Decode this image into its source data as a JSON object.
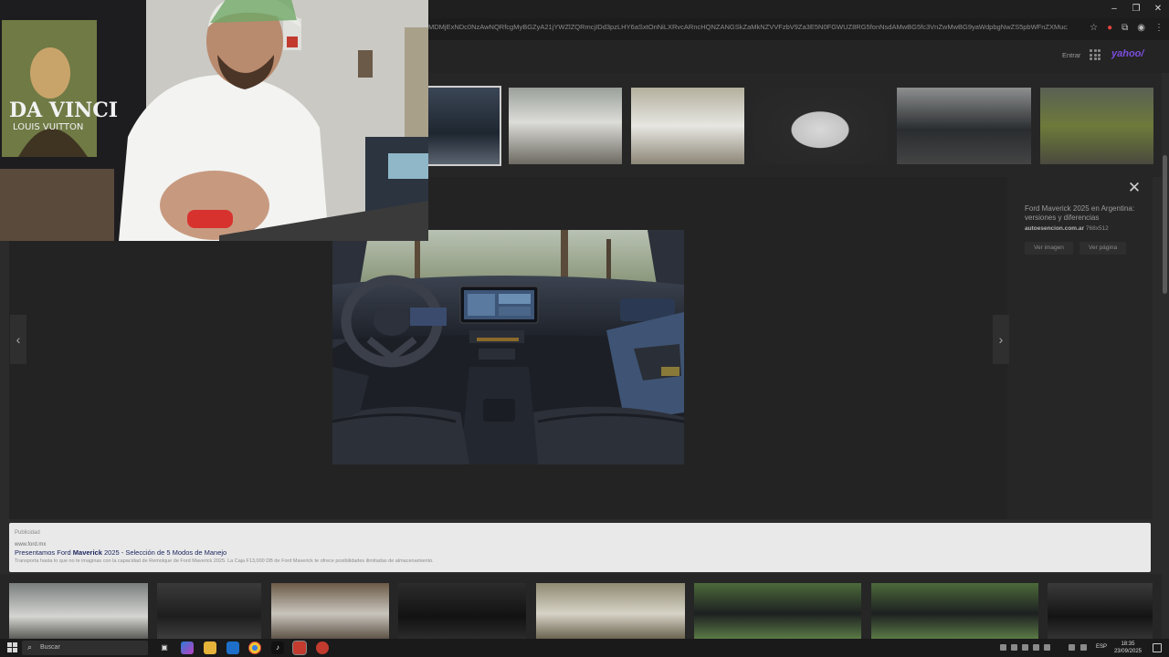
{
  "browser": {
    "url": "MDMjExNDc0NzAwNQRfcgMyBGZyA21jYWZlZQRmcjIDd3pzLHY6aSxtOnNiLXRvcARncHQNZANGSkZaMkNZVVFzbV9Za3E5N0FGWUZ8RG5fonNsdAMwBG5fc3VnZwMwBG9yaWdpbgNwZS5pbWFnZXMuc2VhcmNoLnlhaG9vLmNvbQR",
    "window_controls": [
      "–",
      "❐",
      "✕"
    ],
    "icons": [
      "star-icon",
      "extensions-icon",
      "profile-icon",
      "menu-icon"
    ]
  },
  "header": {
    "enter_label": "Entrar",
    "logo_text": "yahoo/"
  },
  "viewer": {
    "title": "Ford Maverick 2025 en Argentina: versiones y diferencias",
    "source_domain": "autoesencion.com.ar",
    "image_size": "768x512",
    "view_image_label": "Ver imagen",
    "view_page_label": "Ver página",
    "close_icon": "close-icon",
    "prev_icon": "chevron-left-icon",
    "next_icon": "chevron-right-icon"
  },
  "published": {
    "label": "Publicidad",
    "domain": "www.ford.mx",
    "title_prefix": "Presentamos Ford ",
    "title_bold": "Maverick",
    "title_suffix": " 2025 - Selección de 5 Modos de Manejo",
    "description": "Transporta hasta lo que no te imaginas con la capacidad de Remolque de Ford Maverick 2025. La Caja F13,000 DB de Ford Maverick te ofrece posibilidades ilimitadas de almacenamiento."
  },
  "taskbar": {
    "search_placeholder": "Buscar",
    "language": "ESP",
    "time": "18:35",
    "date": "23/09/2025"
  },
  "colors": {
    "yahoo_purple": "#7c4dde",
    "dark_bg": "#232323",
    "ad_title": "#1d2760"
  }
}
